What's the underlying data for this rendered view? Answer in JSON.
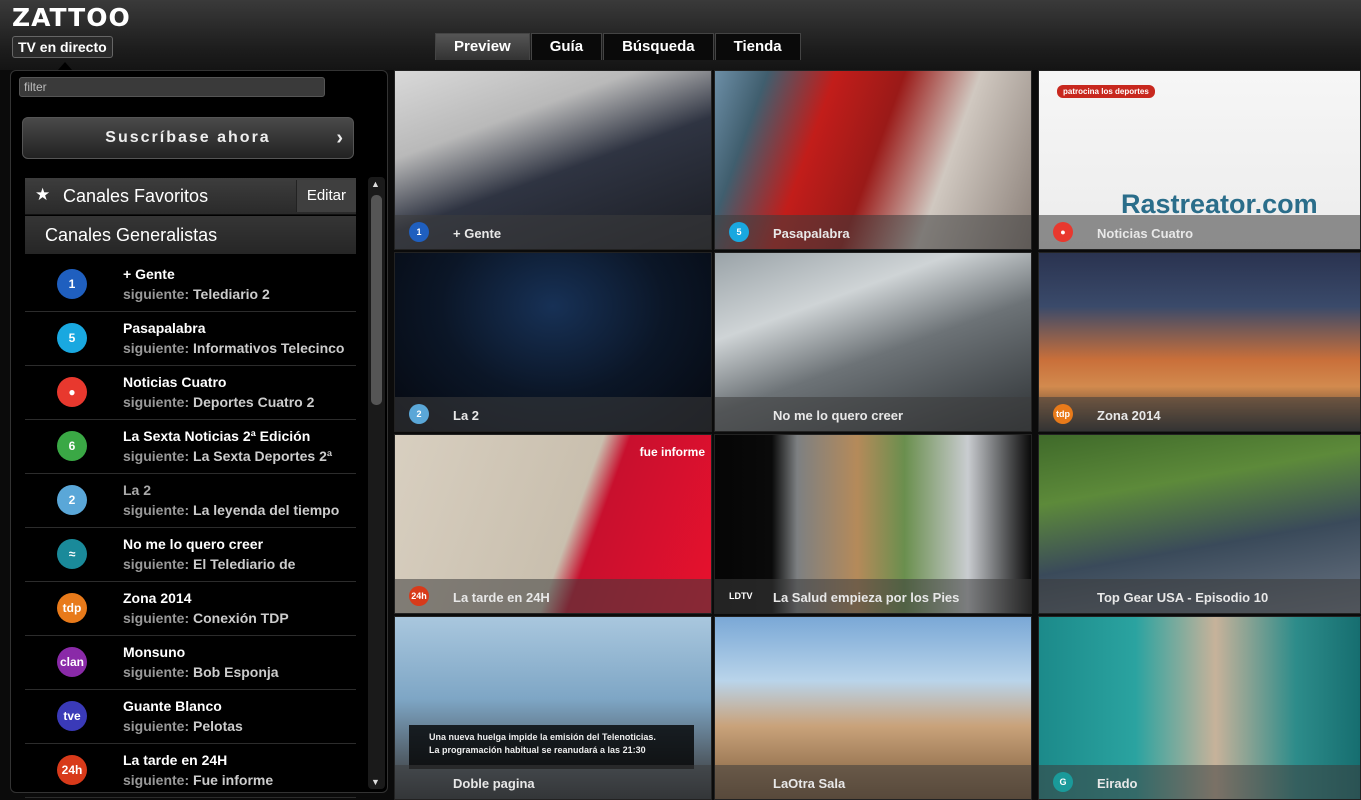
{
  "app": {
    "logo": "ZATTOO",
    "section_tab": "TV en directo"
  },
  "main_tabs": [
    {
      "label": "Preview",
      "active": true
    },
    {
      "label": "Guía",
      "active": false
    },
    {
      "label": "Búsqueda",
      "active": false
    },
    {
      "label": "Tienda",
      "active": false
    }
  ],
  "sidebar": {
    "filter_placeholder": "filter",
    "subscribe_label": "Suscríbase ahora",
    "subscribe_chevron": "›",
    "favorites_label": "Canales Favoritos",
    "edit_label": "Editar",
    "general_label": "Canales Generalistas",
    "next_label": "siguiente:",
    "channels": [
      {
        "logo": "1",
        "name": "+ Gente",
        "next": "Telediario 2",
        "color": "#1f5fbf"
      },
      {
        "logo": "5",
        "name": "Pasapalabra",
        "next": "Informativos Telecinco",
        "color": "#19a8e0"
      },
      {
        "logo": "●",
        "name": "Noticias Cuatro",
        "next": "Deportes Cuatro 2",
        "color": "#e8382e"
      },
      {
        "logo": "6",
        "name": "La Sexta Noticias 2ª Edición",
        "next": "La Sexta Deportes 2ª",
        "color": "#3aa845"
      },
      {
        "logo": "2",
        "name": "La 2",
        "next": "La leyenda del tiempo",
        "color": "#5aa7d8"
      },
      {
        "logo": "≈",
        "name": "No me lo quero creer",
        "next": "El Telediario de",
        "color": "#1a8a9a"
      },
      {
        "logo": "tdp",
        "name": "Zona 2014",
        "next": "Conexión TDP",
        "color": "#e87a1a"
      },
      {
        "logo": "clan",
        "name": "Monsuno",
        "next": "Bob Esponja",
        "color": "#8a2aa8"
      },
      {
        "logo": "tve",
        "name": "Guante Blanco",
        "next": "Pelotas",
        "color": "#3a3ab8"
      },
      {
        "logo": "24h",
        "name": "La tarde en 24H",
        "next": "Fue informe",
        "color": "#d83a1a"
      }
    ]
  },
  "tiles": [
    {
      "caption": "+ Gente",
      "logo": "1"
    },
    {
      "caption": "Pasapalabra",
      "logo": "5"
    },
    {
      "caption": "Noticias Cuatro",
      "logo": "●",
      "sponsor": "patrocina los deportes",
      "brand": "Rastreator.com"
    },
    {
      "caption": "La 2",
      "logo": "2"
    },
    {
      "caption": "No me lo quero creer",
      "logo": ""
    },
    {
      "caption": "Zona 2014",
      "logo": "tdp"
    },
    {
      "caption": "La tarde en 24H",
      "logo": "24h",
      "overlay": "fue informe"
    },
    {
      "caption": "La Salud empieza por los Pies",
      "logo": "LDTV"
    },
    {
      "caption": "Top Gear USA - Episodio 10",
      "logo": ""
    },
    {
      "caption": "Doble pagina",
      "logo": "",
      "ticker_1": "Una nueva huelga impide la emisión del Telenoticias.",
      "ticker_2": "La programación habitual se reanudará a las 21:30"
    },
    {
      "caption": "LaOtra Sala",
      "logo": ""
    },
    {
      "caption": "Eirado",
      "logo": "G"
    }
  ]
}
